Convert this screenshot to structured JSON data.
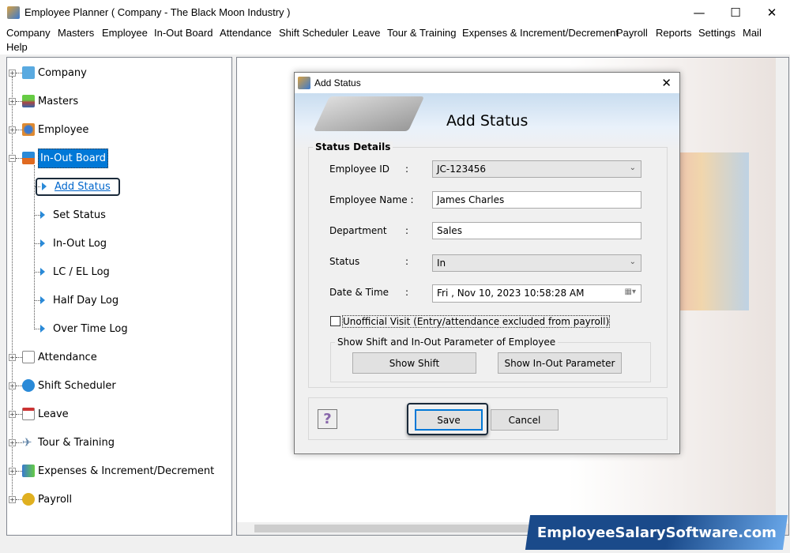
{
  "window": {
    "title": "Employee Planner ( Company - The Black Moon Industry )",
    "minimize": "—",
    "maximize": "☐",
    "close": "✕"
  },
  "menu": [
    "Company",
    "Masters",
    "Employee",
    "In-Out Board",
    "Attendance",
    "Shift Scheduler",
    "Leave",
    "Tour & Training",
    "Expenses & Increment/Decrement",
    "Payroll",
    "Reports",
    "Settings",
    "Mail",
    "Help"
  ],
  "tree": {
    "top": [
      "Company",
      "Masters",
      "Employee",
      "In-Out Board"
    ],
    "children": [
      "Add Status",
      "Set Status",
      "In-Out Log",
      "LC / EL Log",
      "Half Day Log",
      "Over Time Log"
    ],
    "bottom": [
      "Attendance",
      "Shift Scheduler",
      "Leave",
      "Tour & Training",
      "Expenses & Increment/Decrement",
      "Payroll"
    ],
    "selected": "In-Out Board",
    "active_child": "Add Status"
  },
  "dialog": {
    "title": "Add Status",
    "header": "Add Status",
    "group": "Status Details",
    "employee_id_label": "Employee ID",
    "employee_id": "JC-123456",
    "employee_name_label": "Employee Name :",
    "employee_name": "James Charles",
    "department_label": "Department",
    "department": "Sales",
    "status_label": "Status",
    "status": "In",
    "datetime_label": "Date & Time",
    "datetime": "Fri , Nov 10, 2023 10:58:28 AM",
    "colon": ":",
    "unofficial_label": "Unofficial Visit (Entry/attendance excluded from payroll)",
    "unofficial_checked": false,
    "shift_group": "Show Shift and In-Out Parameter of Employee",
    "show_shift": "Show Shift",
    "show_inout": "Show In-Out Parameter",
    "help": "?",
    "save": "Save",
    "cancel": "Cancel",
    "close": "✕"
  },
  "watermark": "EmployeeSalarySoftware.com"
}
